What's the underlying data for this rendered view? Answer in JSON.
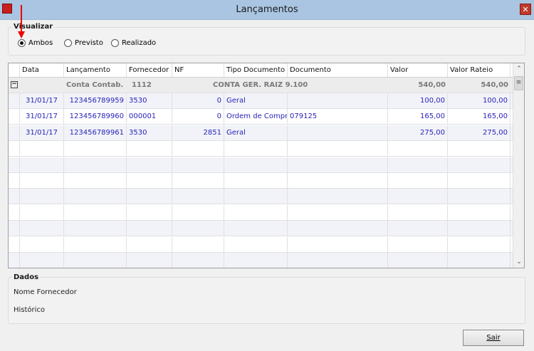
{
  "window": {
    "title": "Lançamentos",
    "close_icon": "close-icon",
    "app_icon": "app-logo-icon"
  },
  "visualizar": {
    "label": "Visualizar",
    "options": [
      "Ambos",
      "Previsto",
      "Realizado"
    ],
    "selected": "Ambos"
  },
  "grid": {
    "columns": [
      "Data",
      "Lançamento",
      "Fornecedor",
      "NF",
      "Tipo Documento",
      "Documento",
      "Valor",
      "Valor Rateio"
    ],
    "group": {
      "label": "Conta Contab.",
      "code": "1112",
      "name": "CONTA GER. RAIZ 9.100",
      "valor": "540,00",
      "valor_rateio": "540,00"
    },
    "rows": [
      {
        "data": "31/01/17",
        "lancamento": "123456789959",
        "fornecedor": "3530",
        "nf": "0",
        "tipo": "Geral",
        "documento": "",
        "valor": "100,00",
        "valor_rateio": "100,00"
      },
      {
        "data": "31/01/17",
        "lancamento": "123456789960",
        "fornecedor": "000001",
        "nf": "0",
        "tipo": "Ordem de Compra",
        "documento": "079125",
        "valor": "165,00",
        "valor_rateio": "165,00"
      },
      {
        "data": "31/01/17",
        "lancamento": "123456789961",
        "fornecedor": "3530",
        "nf": "2851",
        "tipo": "Geral",
        "documento": "",
        "valor": "275,00",
        "valor_rateio": "275,00"
      }
    ]
  },
  "dados": {
    "label": "Dados",
    "nome_fornecedor": "Nome Fornecedor",
    "historico": "Histórico"
  },
  "footer": {
    "sair_label": "Sair"
  },
  "colors": {
    "titlebar": "#a9c5e1",
    "data_text": "#2a23b8",
    "group_text": "#7a7a7a",
    "annotation_arrow": "#e00000"
  }
}
